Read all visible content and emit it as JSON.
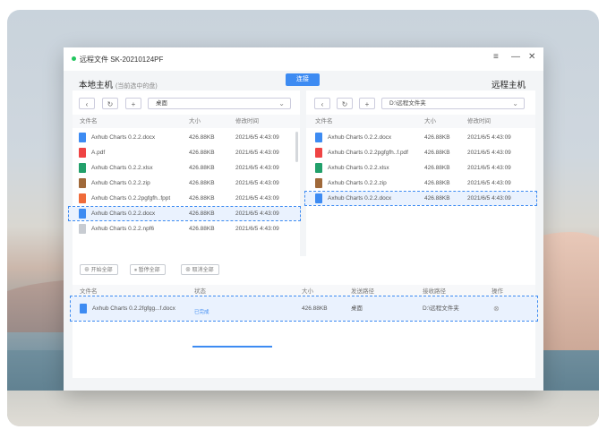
{
  "window": {
    "title": "远程文件 SK-20210124PF",
    "controls": [
      "≡",
      "—",
      "✕"
    ]
  },
  "local": {
    "title": "本地主机",
    "subtitle": "(当前选中的盘)",
    "path": "桌面",
    "toolbar_icons": [
      "back-icon",
      "refresh-icon",
      "new-folder-icon"
    ],
    "columns": [
      "文件名",
      "大小",
      "修改时间"
    ],
    "rows": [
      {
        "name": "Axhub Charts 0.2.2.docx",
        "size": "426.88KB",
        "date": "2021/6/5 4:43:09",
        "type": "doc"
      },
      {
        "name": "A.pdf",
        "size": "426.88KB",
        "date": "2021/6/5 4:43:09",
        "type": "pdf"
      },
      {
        "name": "Axhub Charts 0.2.2.xlsx",
        "size": "426.88KB",
        "date": "2021/6/5 4:43:09",
        "type": "xls"
      },
      {
        "name": "Axhub Charts 0.2.2.zip",
        "size": "426.88KB",
        "date": "2021/6/5 4:43:09",
        "type": "zip"
      },
      {
        "name": "Axhub Charts 0.2.2pgfgfh..fppt",
        "size": "426.88KB",
        "date": "2021/6/5 4:43:09",
        "type": "ppt"
      },
      {
        "name": "Axhub Charts 0.2.2.docx",
        "size": "426.88KB",
        "date": "2021/6/5 4:43:09",
        "type": "doc"
      },
      {
        "name": "Axhub Charts 0.2.2.npf6",
        "size": "426.88KB",
        "date": "2021/6/5 4:43:09",
        "type": "other"
      }
    ]
  },
  "connect_button": "连接",
  "remote": {
    "title": "远程主机",
    "path": "D:\\远程文件夹",
    "columns": [
      "文件名",
      "大小",
      "修改时间"
    ],
    "rows": [
      {
        "name": "Axhub Charts 0.2.2.docx",
        "size": "426.88KB",
        "date": "2021/6/5 4:43:09",
        "type": "doc"
      },
      {
        "name": "Axhub Charts 0.2.2pgfgfh..f.pdf",
        "size": "426.88KB",
        "date": "2021/6/5 4:43:09",
        "type": "pdf"
      },
      {
        "name": "Axhub Charts 0.2.2.xlsx",
        "size": "426.88KB",
        "date": "2021/6/5 4:43:09",
        "type": "xls"
      },
      {
        "name": "Axhub Charts 0.2.2.zip",
        "size": "426.88KB",
        "date": "2021/6/5 4:43:09",
        "type": "zip"
      },
      {
        "name": "Axhub Charts 0.2.2.docx",
        "size": "426.88KB",
        "date": "2021/6/5 4:43:09",
        "type": "doc"
      }
    ]
  },
  "transfer": {
    "buttons": [
      "开始全部",
      "暂停全部",
      "取消全部"
    ],
    "columns": [
      "文件名",
      "状态",
      "大小",
      "发送路径",
      "接收路径",
      "操作"
    ],
    "rows": [
      {
        "name": "Axhub Charts 0.2.2fgfgg...f.docx",
        "status": "已完成",
        "progress": 1.0,
        "size": "426.88KB",
        "send_path": "桌面",
        "recv_path": "D:\\远程文件夹",
        "action_icon": "circle-close-icon"
      }
    ]
  },
  "colors": {
    "accent": "#3d8bf2",
    "doc": "#3d8bf2",
    "pdf": "#ef4444",
    "xls": "#22a06b",
    "zip": "#a0693a",
    "ppt": "#ef6b3a",
    "other": "#c8ccd2"
  }
}
